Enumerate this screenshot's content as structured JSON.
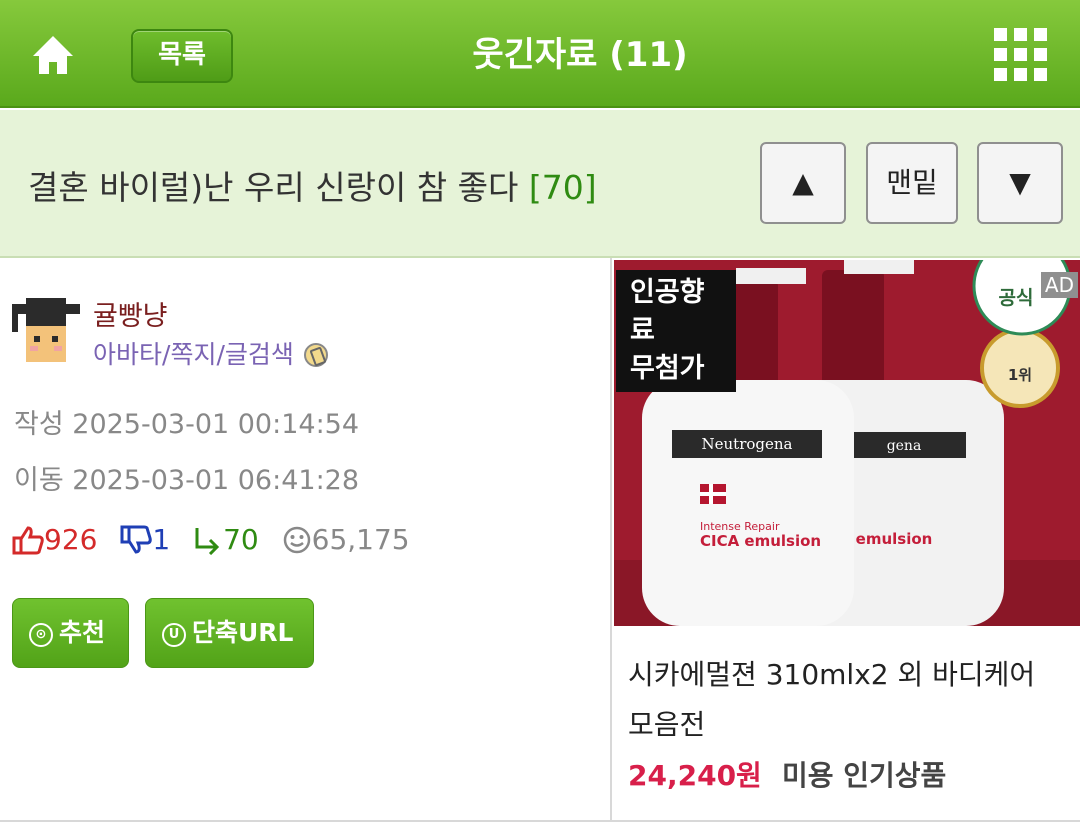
{
  "header": {
    "list_label": "목록",
    "board_title": "웃긴자료 (11)",
    "home_icon": "home-icon",
    "menu_icon": "grid-menu-icon"
  },
  "post": {
    "title": "결혼 바이럴)난 우리 신랑이 참 좋다",
    "comment_count": "[70]",
    "nav": {
      "up": "▲",
      "bottom": "맨밑",
      "down": "▼"
    }
  },
  "author": {
    "nickname": "귤빵냥",
    "link_avatar": "아바타",
    "link_message": "쪽지",
    "link_search": "글검색",
    "sep": "/"
  },
  "meta": {
    "created": "작성 2025-03-01 00:14:54",
    "moved": "이동 2025-03-01 06:41:28"
  },
  "stats": {
    "likes": "926",
    "dislikes": "1",
    "replies": "70",
    "views": "65,175"
  },
  "actions": {
    "recommend": "추천",
    "recommend_icon": "⊙",
    "shorturl": "단축URL",
    "shorturl_icon": "U"
  },
  "ad": {
    "badge": "인공향료\n무첨가",
    "mark": "AD",
    "brand": "Neutrogena",
    "product_line1": "Intense Repair",
    "product_line2": "CICA emulsion",
    "title": "시카에멀젼 310mlx2 외 바디케어 모음전",
    "price": "24,240원",
    "category": "미용 인기상품",
    "award_rank": "1위",
    "official": "공식"
  },
  "colors": {
    "header_green": "#5aa91c",
    "subbar": "#e6f3d8",
    "count_green": "#2f8b12",
    "nick": "#7a1f1f",
    "links": "#7a63b3",
    "like_red": "#d42a2a",
    "dislike_blue": "#1f3fb5",
    "ad_red": "#9e1b2e",
    "price": "#d81f4a"
  }
}
